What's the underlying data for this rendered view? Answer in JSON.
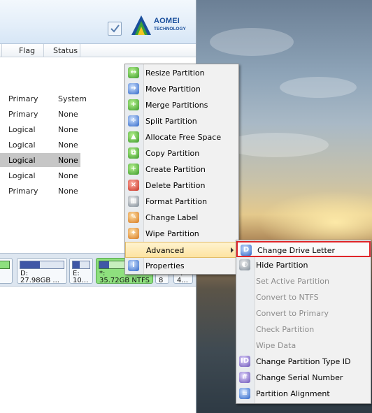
{
  "app": {
    "brand": "AOMEI",
    "brand_sub": "TECHNOLOGY",
    "columns": {
      "flag": "Flag",
      "status": "Status"
    },
    "rows": [
      {
        "flag": "Primary",
        "status": "System"
      },
      {
        "flag": "Primary",
        "status": "None"
      },
      {
        "flag": "Logical",
        "status": "None"
      },
      {
        "flag": "Logical",
        "status": "None"
      },
      {
        "flag": "Logical",
        "status": "None",
        "selected": true
      },
      {
        "flag": "Logical",
        "status": "None"
      },
      {
        "flag": "Primary",
        "status": "None"
      }
    ],
    "disk_partitions": [
      {
        "label": "D:",
        "size": "27.98GB ...",
        "used_fraction": 0.45
      },
      {
        "label": "E:",
        "size": "10...",
        "used_fraction": 0.4
      },
      {
        "label": "*:",
        "size": "35.72GB NTFS",
        "used_fraction": 0.2,
        "selected": true
      },
      {
        "label": "*",
        "size": "8",
        "used_fraction": 0.5
      },
      {
        "label": "*:",
        "size": "4...",
        "used_fraction": 0.5
      }
    ]
  },
  "context_menu": {
    "items": [
      {
        "label": "Resize Partition",
        "icon": "resize-partition-icon"
      },
      {
        "label": "Move Partition",
        "icon": "move-partition-icon"
      },
      {
        "label": "Merge Partitions",
        "icon": "merge-partitions-icon"
      },
      {
        "label": "Split Partition",
        "icon": "split-partition-icon"
      },
      {
        "label": "Allocate Free Space",
        "icon": "allocate-free-space-icon"
      },
      {
        "label": "Copy Partition",
        "icon": "copy-partition-icon"
      },
      {
        "label": "Create Partition",
        "icon": "create-partition-icon"
      },
      {
        "label": "Delete Partition",
        "icon": "delete-partition-icon"
      },
      {
        "label": "Format Partition",
        "icon": "format-partition-icon"
      },
      {
        "label": "Change Label",
        "icon": "change-label-icon"
      },
      {
        "label": "Wipe Partition",
        "icon": "wipe-partition-icon"
      },
      {
        "label": "Advanced",
        "icon": "",
        "submenu": true,
        "highlighted": true
      },
      {
        "label": "Properties",
        "icon": "properties-icon"
      }
    ]
  },
  "advanced_submenu": {
    "items": [
      {
        "label": "Change Drive Letter",
        "enabled": true,
        "boxed": true,
        "icon": "change-drive-letter-icon"
      },
      {
        "label": "Hide Partition",
        "enabled": true,
        "icon": "hide-partition-icon"
      },
      {
        "label": "Set Active Partition",
        "enabled": false
      },
      {
        "label": "Convert to NTFS",
        "enabled": false
      },
      {
        "label": "Convert to Primary",
        "enabled": false
      },
      {
        "label": "Check Partition",
        "enabled": false
      },
      {
        "label": "Wipe Data",
        "enabled": false
      },
      {
        "label": "Change Partition Type ID",
        "enabled": true,
        "icon": "change-partition-type-id-icon"
      },
      {
        "label": "Change Serial Number",
        "enabled": true,
        "icon": "change-serial-number-icon"
      },
      {
        "label": "Partition Alignment",
        "enabled": true,
        "icon": "partition-alignment-icon"
      }
    ]
  },
  "colors": {
    "highlight": "#fde3a1",
    "selected_partition": "#8ee07e",
    "box_outline": "#e0262a",
    "brand": "#1a4f9c"
  }
}
